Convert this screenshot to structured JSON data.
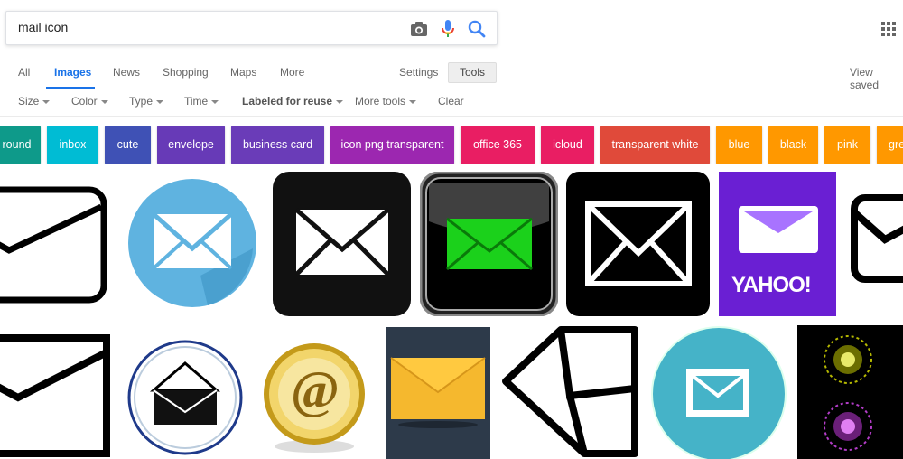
{
  "search": {
    "query": "mail icon"
  },
  "tabs": [
    "All",
    "Images",
    "News",
    "Shopping",
    "Maps",
    "More",
    "Settings",
    "Tools"
  ],
  "view_saved": "View saved",
  "filters": [
    "Size",
    "Color",
    "Type",
    "Time",
    "Labeled for reuse",
    "More tools",
    "Clear"
  ],
  "chips": [
    {
      "label": "round",
      "color": "#0e9a8a"
    },
    {
      "label": "inbox",
      "color": "#00bcd4"
    },
    {
      "label": "cute",
      "color": "#3f51b5"
    },
    {
      "label": "envelope",
      "color": "#673ab7"
    },
    {
      "label": "business card",
      "color": "#6a3cb8"
    },
    {
      "label": "icon png transparent",
      "color": "#9c27b0"
    },
    {
      "label": "office 365",
      "color": "#e91e63"
    },
    {
      "label": "icloud",
      "color": "#e91e63"
    },
    {
      "label": "transparent white",
      "color": "#e04a3a"
    },
    {
      "label": "blue",
      "color": "#ff9800"
    },
    {
      "label": "black",
      "color": "#ff9800"
    },
    {
      "label": "pink",
      "color": "#ff9800"
    },
    {
      "label": "gre",
      "color": "#ff9800"
    }
  ],
  "images": {
    "yahoo_text": "YAHOO!",
    "at_symbol": "@"
  }
}
